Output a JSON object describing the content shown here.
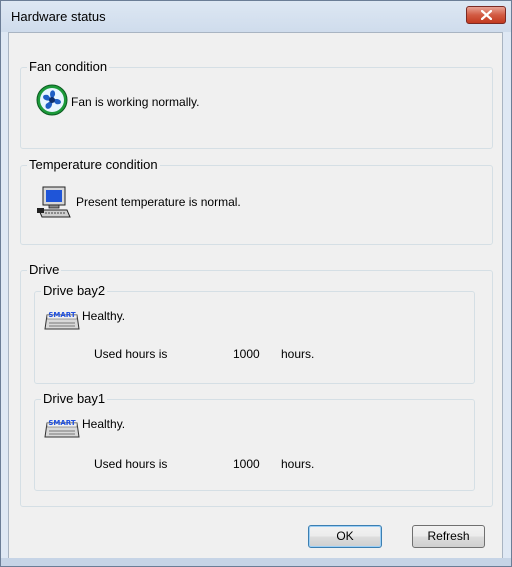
{
  "window": {
    "title": "Hardware status"
  },
  "fan": {
    "group_label": "Fan condition",
    "status": "Fan is working normally.",
    "icon": "fan-icon"
  },
  "temperature": {
    "group_label": "Temperature condition",
    "status": "Present temperature is normal.",
    "icon": "computer-icon"
  },
  "drive": {
    "group_label": "Drive",
    "bays": [
      {
        "label": "Drive bay2",
        "health": "Healthy.",
        "used_label": "Used hours is",
        "hours": "1000",
        "unit": "hours.",
        "icon": "smart-drive-icon",
        "icon_text": "SMART"
      },
      {
        "label": "Drive bay1",
        "health": "Healthy.",
        "used_label": "Used hours is",
        "hours": "1000",
        "unit": "hours.",
        "icon": "smart-drive-icon",
        "icon_text": "SMART"
      }
    ]
  },
  "buttons": {
    "ok": "OK",
    "refresh": "Refresh"
  },
  "colors": {
    "title_bg": "#dde7f3",
    "client_bg": "#f0f0f0",
    "close_red": "#c23a1f",
    "default_btn_border": "#3c7fb1"
  }
}
